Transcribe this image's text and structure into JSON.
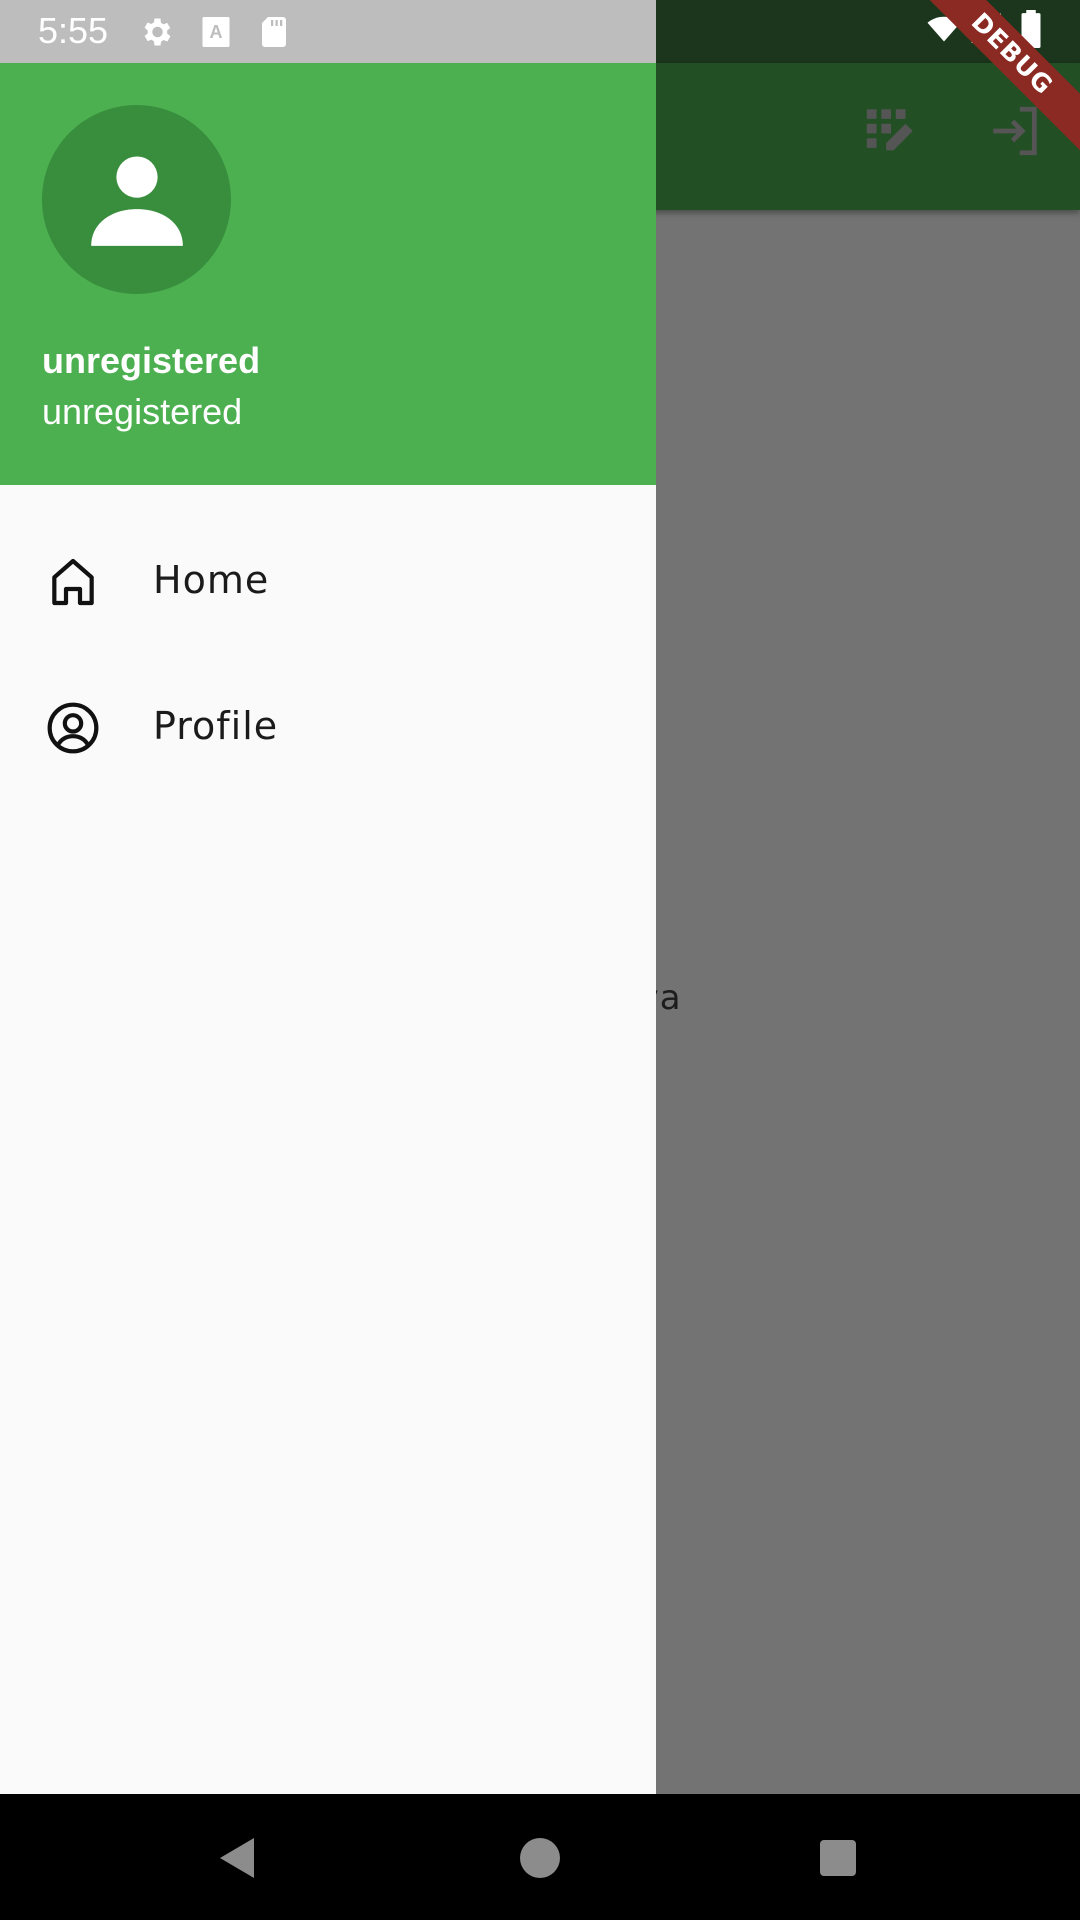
{
  "status_bar": {
    "time": "5:55",
    "left_icons": [
      "gear-icon",
      "text-a-icon",
      "sd-card-icon"
    ],
    "right_icons": [
      "wifi-icon",
      "signal-icon",
      "battery-icon"
    ]
  },
  "debug_banner": {
    "label": "DEBUG",
    "color": "#8a2a23"
  },
  "background_app": {
    "appbar_color": "#234f25",
    "actions": [
      {
        "icon": "grid-edit-icon"
      },
      {
        "icon": "login-icon"
      }
    ],
    "body_text": "y Raya"
  },
  "drawer": {
    "header_color": "#4caf50",
    "account": {
      "avatar_icon": "person-icon",
      "name": "unregistered",
      "email": "unregistered"
    },
    "items": [
      {
        "label": "Home",
        "icon": "home-icon"
      },
      {
        "label": "Profile",
        "icon": "account-circle-icon"
      }
    ]
  },
  "nav_bar": {
    "buttons": [
      "back-icon",
      "home-circle-icon",
      "recents-icon"
    ]
  }
}
